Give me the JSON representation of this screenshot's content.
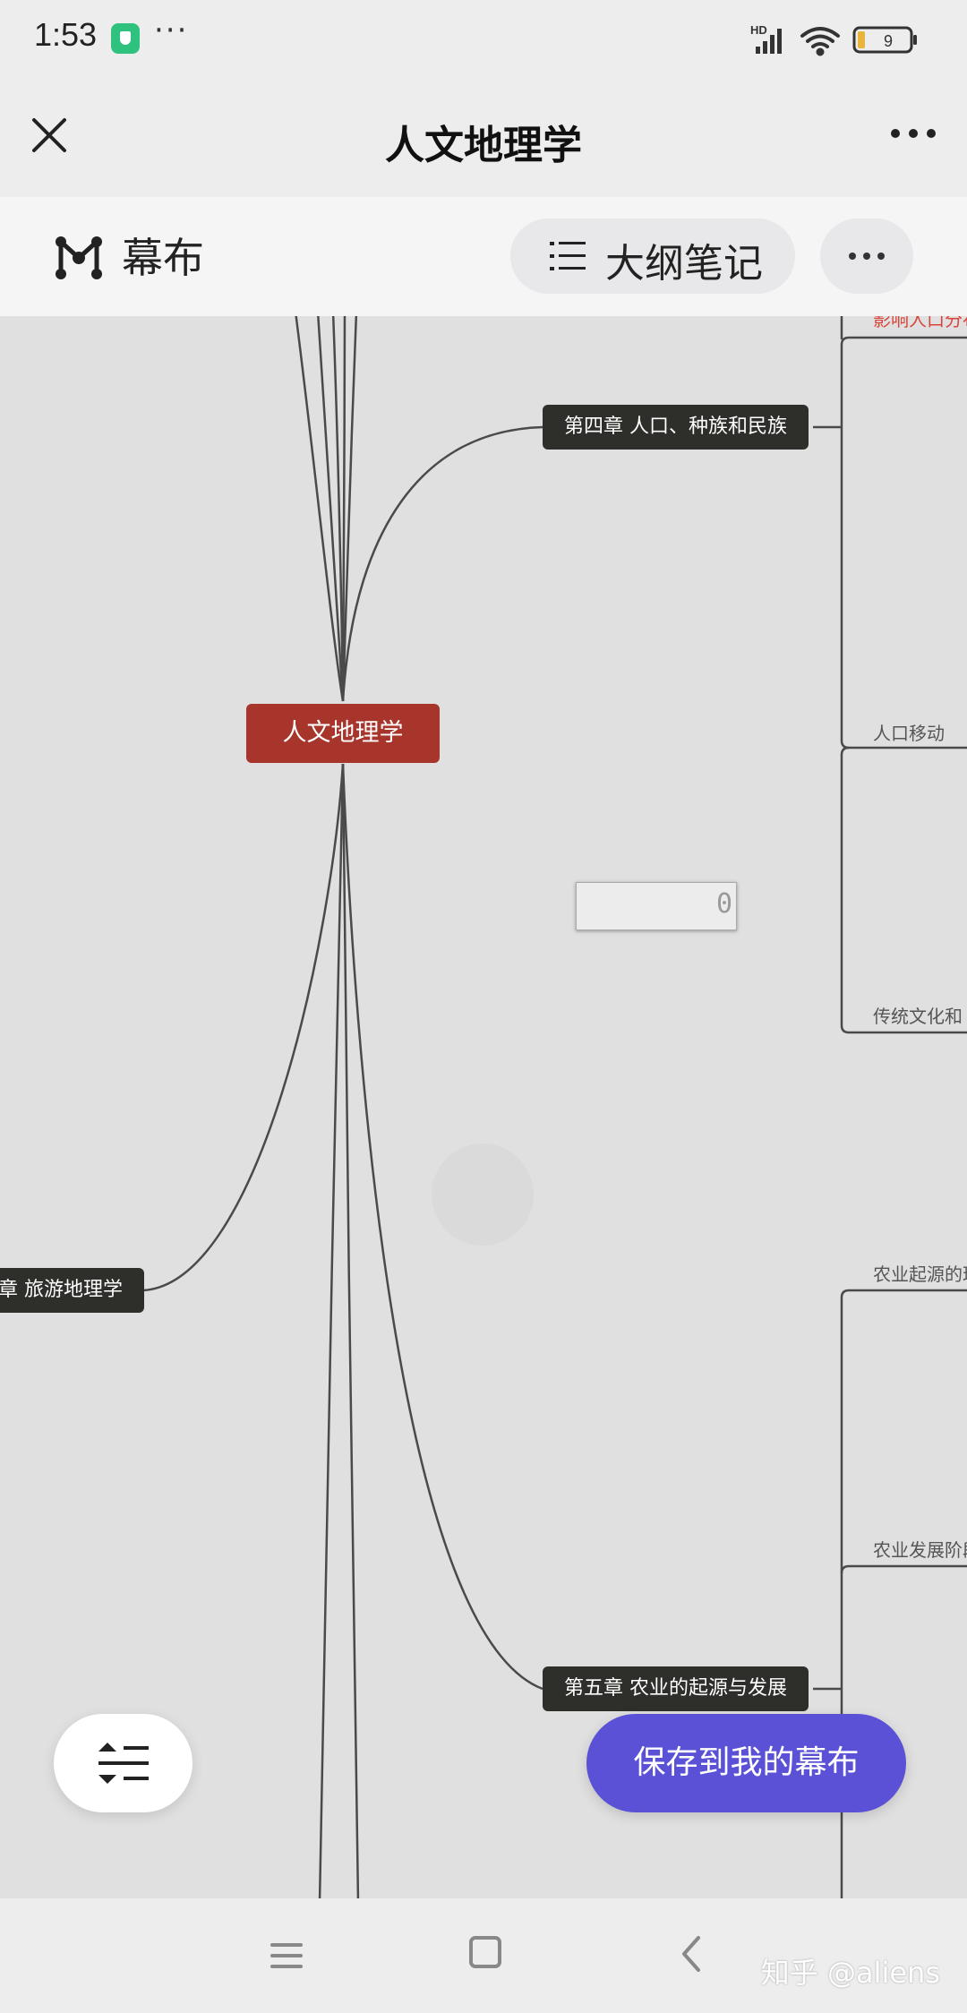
{
  "status_bar": {
    "time": "1:53",
    "dots": "···",
    "hd": "HD",
    "battery": "9"
  },
  "header": {
    "title": "人文地理学"
  },
  "mubu_bar": {
    "app_name": "幕布",
    "outline_label": "大纲笔记"
  },
  "mindmap": {
    "root": "人文地理学",
    "chapter4": "第四章 人口、种族和民族",
    "chapter5": "第五章 农业的起源与发展",
    "tourism": "章 旅游地理学",
    "leaves": {
      "top_red": "影响人口分布",
      "population_move": "人口移动",
      "culture": "传统文化和",
      "agri_origin": "农业起源的理",
      "agri_stage": "农业发展阶段"
    },
    "edit_cursor": "0"
  },
  "save_button": "保存到我的幕布",
  "watermark": "知乎 @aliens",
  "colors": {
    "root": "#a8352b",
    "dark_node": "#2e2e2a",
    "accent": "#5a51d6"
  }
}
